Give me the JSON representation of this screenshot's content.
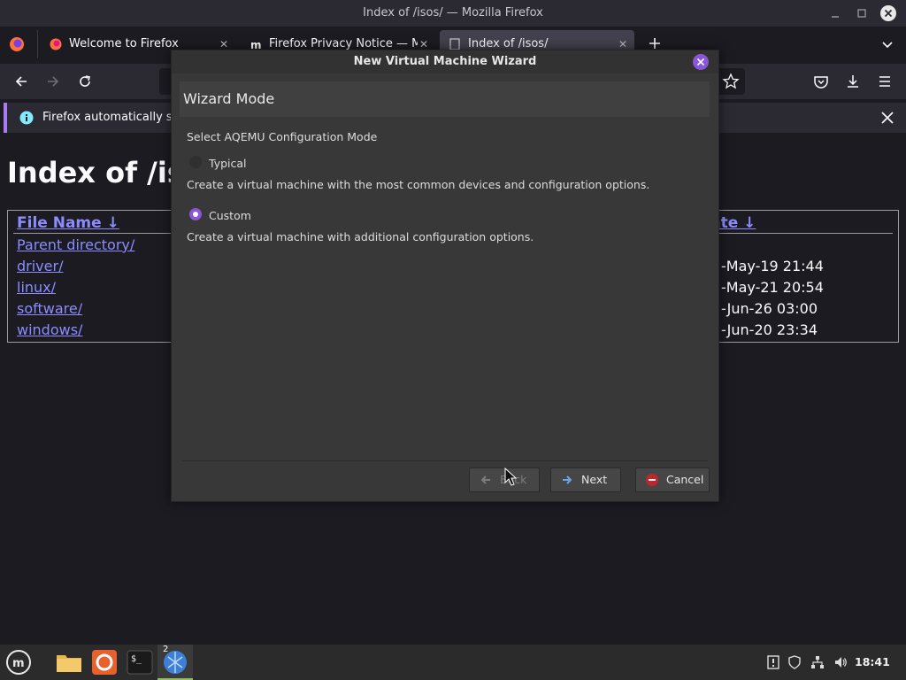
{
  "window": {
    "title": "Index of /isos/ — Mozilla Firefox"
  },
  "tabs": [
    {
      "label": "Welcome to Firefox",
      "close": "✕"
    },
    {
      "label": "Firefox Privacy Notice — Mozilla",
      "close": "✕"
    },
    {
      "label": "Index of /isos/",
      "close": "✕"
    }
  ],
  "notification": {
    "text": "Firefox automatically sends some data to Mozilla so that we can improve your experience."
  },
  "page": {
    "heading": "Index of /isos/",
    "columns": {
      "name": "File Name ↓",
      "date": "Date ↓"
    },
    "rows": [
      {
        "name": "Parent directory/",
        "date": ""
      },
      {
        "name": "driver/",
        "date": "-May-19 21:44"
      },
      {
        "name": "linux/",
        "date": "-May-21 20:54"
      },
      {
        "name": "software/",
        "date": "-Jun-26 03:00"
      },
      {
        "name": "windows/",
        "date": "-Jun-20 23:34"
      }
    ]
  },
  "dialog": {
    "title": "New Virtual Machine Wizard",
    "header": "Wizard Mode",
    "prompt": "Select AQEMU Configuration Mode",
    "options": [
      {
        "label": "Typical",
        "description": "Create a virtual machine with the most common devices and configuration options.",
        "selected": false
      },
      {
        "label": "Custom",
        "description": "Create a virtual machine with additional configuration options.",
        "selected": true
      }
    ],
    "buttons": {
      "back": "Back",
      "next": "Next",
      "cancel": "Cancel"
    }
  },
  "taskbar": {
    "clock": "18:41",
    "workspace_badge": "2"
  },
  "colors": {
    "accent": "#8a55d6",
    "link": "#8c8cff",
    "notif_bar": "#a97bf3"
  }
}
